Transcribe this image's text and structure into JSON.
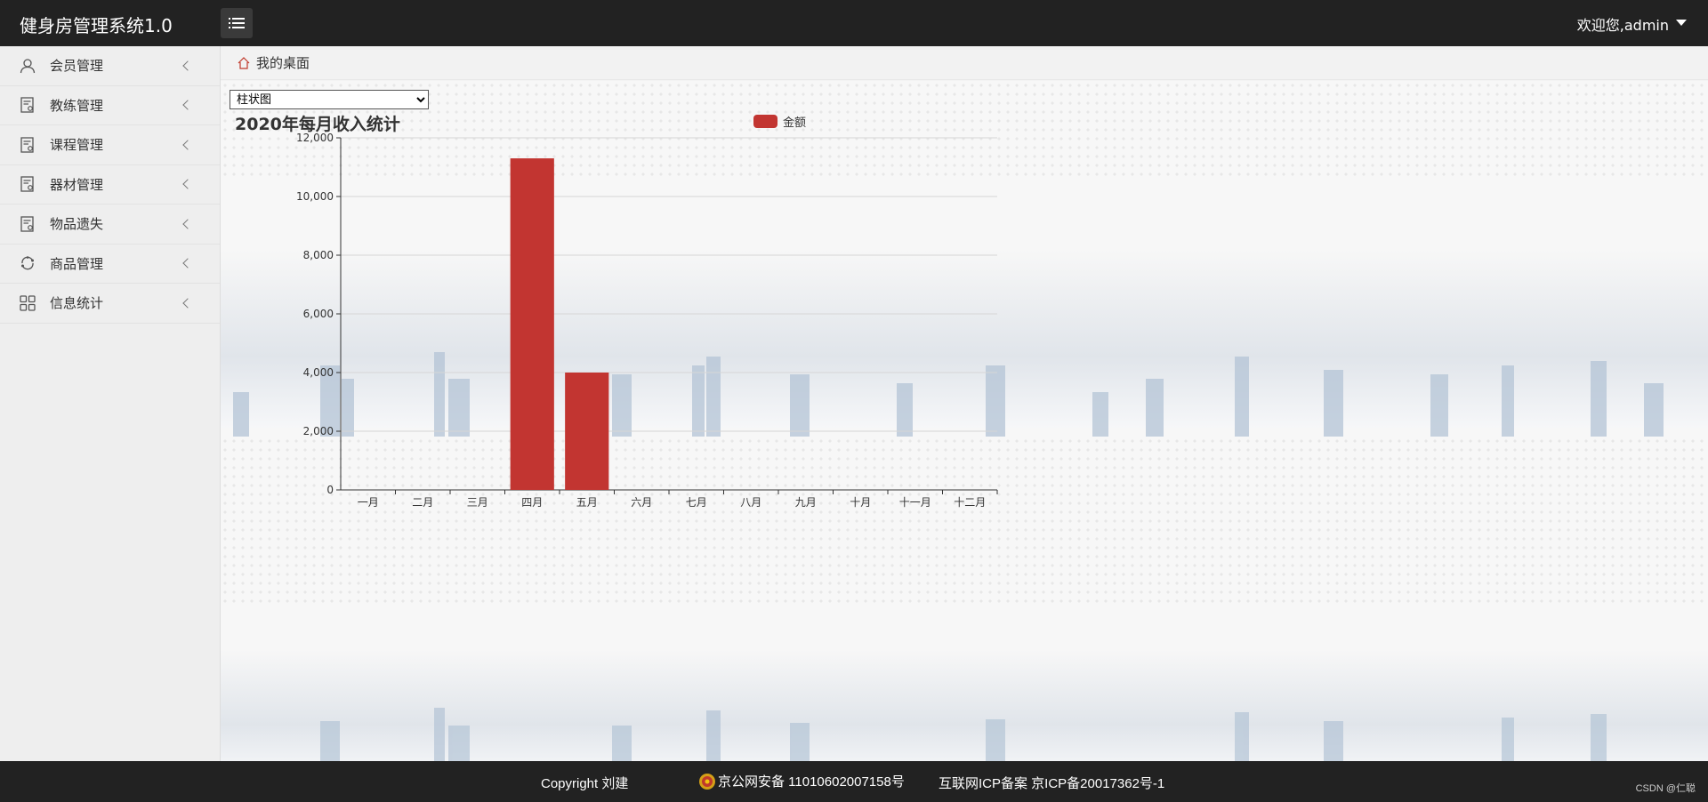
{
  "app": {
    "title": "健身房管理系统1.0",
    "welcome": "欢迎您,admin"
  },
  "sidebar": {
    "items": [
      {
        "label": "会员管理",
        "icon": "user-icon"
      },
      {
        "label": "教练管理",
        "icon": "document-icon"
      },
      {
        "label": "课程管理",
        "icon": "document-icon"
      },
      {
        "label": "器材管理",
        "icon": "document-icon"
      },
      {
        "label": "物品遗失",
        "icon": "document-icon"
      },
      {
        "label": "商品管理",
        "icon": "refresh-icon"
      },
      {
        "label": "信息统计",
        "icon": "grid-icon"
      }
    ]
  },
  "breadcrumb": {
    "label": "我的桌面"
  },
  "chart_select": {
    "selected": "柱状图"
  },
  "chart_data": {
    "type": "bar",
    "title": "2020年每月收入统计",
    "categories": [
      "一月",
      "二月",
      "三月",
      "四月",
      "五月",
      "六月",
      "七月",
      "八月",
      "九月",
      "十月",
      "十一月",
      "十二月"
    ],
    "series": [
      {
        "name": "金额",
        "values": [
          0,
          0,
          0,
          11300,
          4000,
          0,
          0,
          0,
          0,
          0,
          0,
          0
        ]
      }
    ],
    "ylim": [
      0,
      12000
    ],
    "yticks": [
      "0",
      "2,000",
      "4,000",
      "6,000",
      "8,000",
      "10,000",
      "12,000"
    ],
    "ytick_values": [
      0,
      2000,
      4000,
      6000,
      8000,
      10000,
      12000
    ],
    "grid": true,
    "legend": "top",
    "color": "#c23531"
  },
  "footer": {
    "copyright": "Copyright 刘建",
    "police": "京公网安备 11010602007158号",
    "icp": "互联网ICP备案 京ICP备20017362号-1",
    "watermark": "CSDN @仁聪"
  },
  "colors": {
    "topbar": "#222222",
    "accent": "#c23531"
  }
}
